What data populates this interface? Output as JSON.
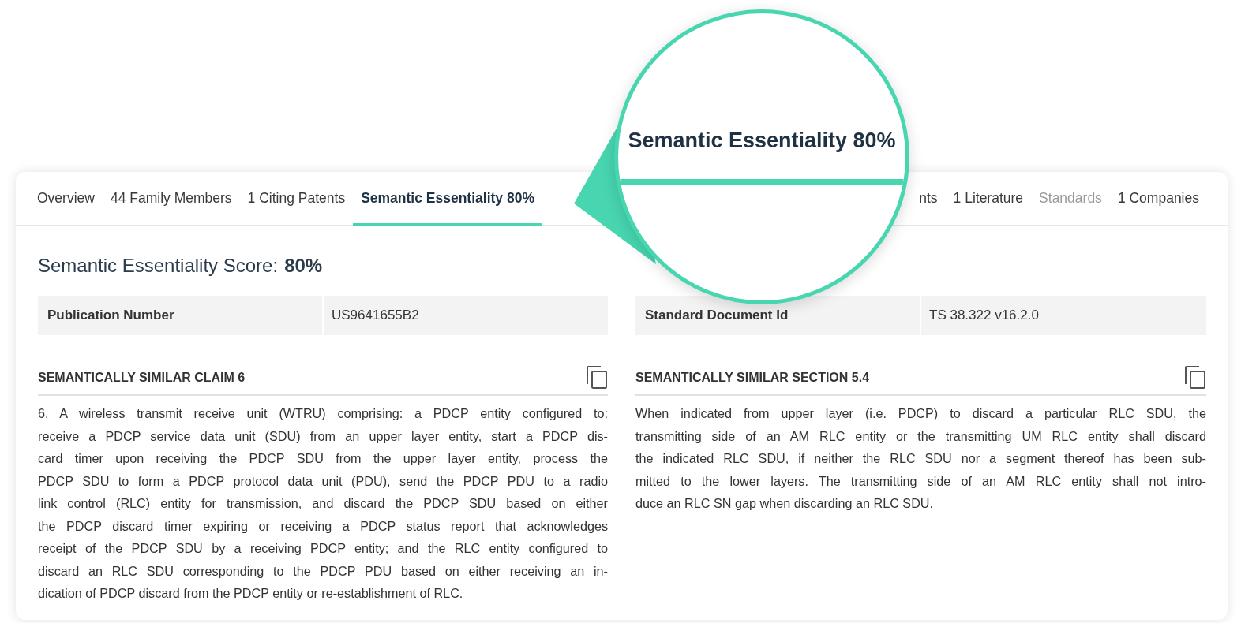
{
  "tabs": [
    {
      "label": "Overview",
      "selected": false,
      "disabled": false
    },
    {
      "label": "44 Family Members",
      "selected": false,
      "disabled": false
    },
    {
      "label": "1 Citing Patents",
      "selected": false,
      "disabled": false
    },
    {
      "label": "Semantic Essentiality 80%",
      "selected": true,
      "disabled": false
    },
    {
      "label": "nts",
      "selected": false,
      "disabled": false
    },
    {
      "label": "1 Literature",
      "selected": false,
      "disabled": false
    },
    {
      "label": "Standards",
      "selected": false,
      "disabled": true
    },
    {
      "label": "1 Companies",
      "selected": false,
      "disabled": false
    }
  ],
  "score": {
    "label": "Semantic Essentiality Score:",
    "value": "80%"
  },
  "columns": [
    {
      "field": {
        "label": "Publication Number",
        "value": "US9641655B2"
      },
      "section_title": "SEMANTICALLY SIMILAR CLAIM 6",
      "lines": [
        "6. A wireless transmit receive unit (WTRU) comprising: a PDCP entity configured to:",
        "receive a PDCP service data unit (SDU) from an upper layer entity, start a PDCP dis-",
        "card timer upon receiving the PDCP SDU from the upper layer entity, process the",
        "PDCP SDU to form a PDCP protocol data unit (PDU), send the PDCP PDU to a radio",
        "link control (RLC) entity for transmission, and discard the PDCP SDU based on either",
        "the PDCP discard timer expiring or receiving a PDCP status report that acknowledges",
        "receipt of the PDCP SDU by a receiving PDCP entity; and the RLC entity configured to",
        "discard an RLC SDU corresponding to the PDCP PDU based on either receiving an in-",
        "dication of PDCP discard from the PDCP entity or re-establishment of RLC."
      ]
    },
    {
      "field": {
        "label": "Standard Document Id",
        "value": "TS 38.322 v16.2.0"
      },
      "section_title": "SEMANTICALLY SIMILAR SECTION 5.4",
      "lines": [
        "When indicated from upper layer (i.e. PDCP) to discard a particular RLC SDU, the",
        "transmitting side of an AM RLC entity or the transmitting UM RLC entity shall discard",
        "the indicated RLC SDU, if neither the RLC SDU nor a segment thereof has been sub-",
        "mitted to the lower layers. The transmitting side of an AM RLC entity shall not intro-",
        "duce an RLC SN gap when discarding an RLC SDU."
      ]
    }
  ],
  "magnifier": {
    "label": "Semantic Essentiality 80%"
  }
}
